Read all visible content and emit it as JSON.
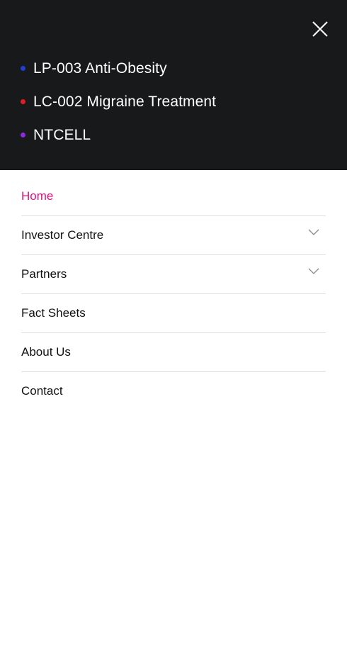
{
  "close_icon": "close-icon",
  "colors": {
    "top_background": "#18191b",
    "active": "#e0107e",
    "bullet_blue": "#1f3fd6",
    "bullet_red": "#e31b23",
    "bullet_purple": "#8a2be2"
  },
  "pipeline": [
    {
      "label": "LP-003 Anti-Obesity",
      "color": "#1f3fd6"
    },
    {
      "label": "LC-002 Migraine Treatment",
      "color": "#e31b23"
    },
    {
      "label": "NTCELL",
      "color": "#8a2be2"
    }
  ],
  "menu": [
    {
      "label": "Home",
      "active": true,
      "has_submenu": false
    },
    {
      "label": "Investor Centre",
      "active": false,
      "has_submenu": true
    },
    {
      "label": "Partners",
      "active": false,
      "has_submenu": true
    },
    {
      "label": "Fact Sheets",
      "active": false,
      "has_submenu": false
    },
    {
      "label": "About Us",
      "active": false,
      "has_submenu": false
    },
    {
      "label": "Contact",
      "active": false,
      "has_submenu": false
    }
  ]
}
